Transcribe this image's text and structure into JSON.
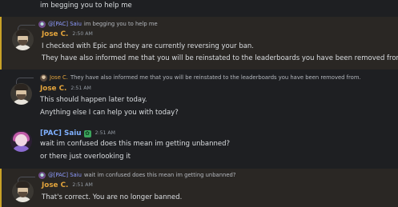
{
  "messages": {
    "top_continuation": "im begging you to help me",
    "m1": {
      "reply_name": "@[PAC] Saiu",
      "reply_text": "im begging you to help me",
      "author": "Jose C.",
      "time": "2:50 AM",
      "lines": [
        "I checked with Epic and they are currently reversing your ban.",
        "They have also informed me that you will be reinstated to the leaderboards you have been removed from."
      ]
    },
    "m2": {
      "reply_name": "Jose C.",
      "reply_text": "They have also informed me that you will be reinstated to the leaderboards you have been removed from.",
      "author": "Jose C.",
      "time": "2:51 AM",
      "lines": [
        "This should happen later today.",
        "Anything else I can help you with today?"
      ]
    },
    "m3": {
      "author": "[PAC] Saiu",
      "badge_icon": "frog-icon",
      "time": "2:51 AM",
      "lines": [
        "wait im confused does this mean im getting unbanned?",
        "or there just overlooking it"
      ]
    },
    "m4": {
      "reply_name": "@[PAC] Saiu",
      "reply_text": "wait im confused does this mean im getting unbanned?",
      "author": "Jose C.",
      "time": "2:51 AM",
      "lines": [
        "That's correct. You are no longer banned."
      ]
    }
  },
  "colors": {
    "background": "#1e1f22",
    "highlight_bg": "#2a2724",
    "highlight_border": "#c9a227",
    "jose_name": "#e3a43c",
    "saiu_name": "#7fb0ff",
    "mention": "#8e9cff"
  }
}
